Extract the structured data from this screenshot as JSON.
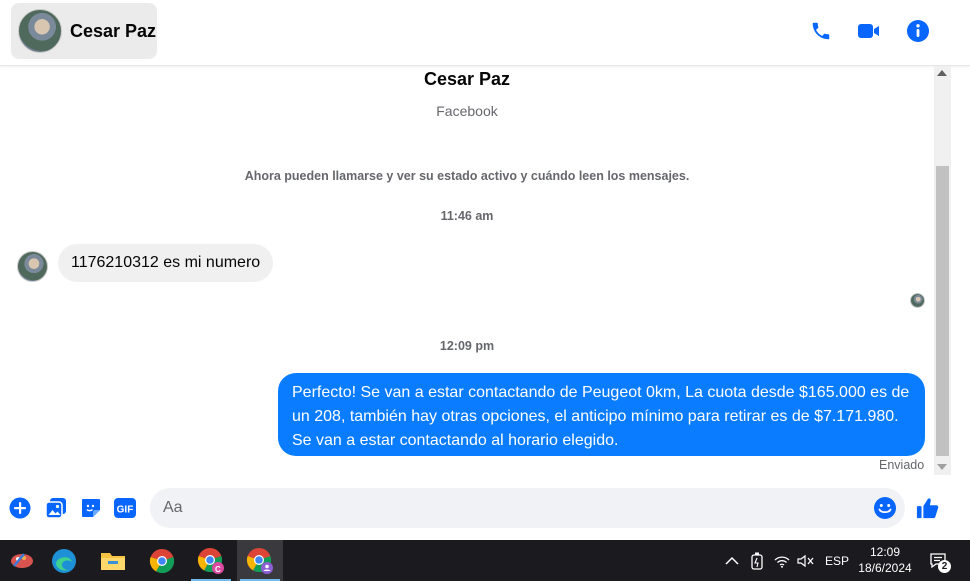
{
  "header": {
    "contact_name": "Cesar Paz"
  },
  "conversation": {
    "profile_name": "Cesar Paz",
    "profile_subtitle": "Facebook",
    "system_message": "Ahora pueden llamarse y ver su estado activo y cuándo leen los mensajes.",
    "timestamp_1": "11:46 am",
    "incoming_message": "1176210312 es mi numero",
    "timestamp_2": "12:09 pm",
    "outgoing_message": "Perfecto! Se van a estar contactando de Peugeot 0km, La cuota desde $165.000 es de un 208, también hay otras opciones, el anticipo mínimo para retirar es de $7.171.980. Se van a estar contactando al horario elegido.",
    "sent_status": "Enviado"
  },
  "composer": {
    "placeholder": "Aa"
  },
  "taskbar": {
    "language": "ESP",
    "time": "12:09",
    "date": "18/6/2024",
    "notification_count": "2",
    "chrome_badge_1": "C"
  },
  "colors": {
    "accent": "#0a7cff",
    "header_icon": "#0866ff"
  }
}
